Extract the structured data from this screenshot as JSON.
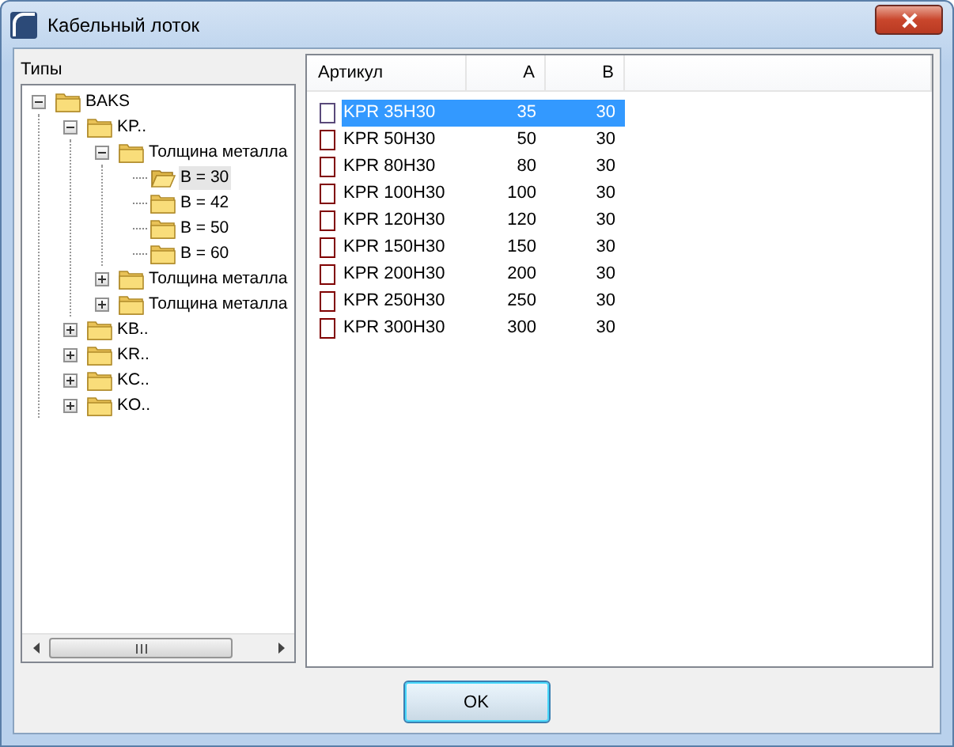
{
  "window": {
    "title": "Кабельный лоток"
  },
  "tree": {
    "label": "Типы",
    "nodes": [
      {
        "label": "BAKS",
        "expanded": true,
        "selected": false,
        "children": [
          {
            "label": "KP..",
            "expanded": true,
            "selected": false,
            "children": [
              {
                "label": "Толщина металла",
                "expanded": true,
                "selected": false,
                "children": [
                  {
                    "label": "B = 30",
                    "selected": true
                  },
                  {
                    "label": "B = 42",
                    "selected": false
                  },
                  {
                    "label": "B = 50",
                    "selected": false
                  },
                  {
                    "label": "B = 60",
                    "selected": false
                  }
                ]
              },
              {
                "label": "Толщина металла",
                "expanded": false,
                "selected": false
              },
              {
                "label": "Толщина металла",
                "expanded": false,
                "selected": false
              }
            ]
          },
          {
            "label": "KB..",
            "expanded": false,
            "selected": false
          },
          {
            "label": "KR..",
            "expanded": false,
            "selected": false
          },
          {
            "label": "KC..",
            "expanded": false,
            "selected": false
          },
          {
            "label": "KO..",
            "expanded": false,
            "selected": false
          }
        ]
      }
    ]
  },
  "table": {
    "columns": [
      "Артикул",
      "A",
      "B"
    ],
    "rows": [
      {
        "cells": [
          "KPR 35H30",
          "35",
          "30"
        ],
        "checked": false,
        "selected": true
      },
      {
        "cells": [
          "KPR 50H30",
          "50",
          "30"
        ],
        "checked": false,
        "selected": false
      },
      {
        "cells": [
          "KPR 80H30",
          "80",
          "30"
        ],
        "checked": false,
        "selected": false
      },
      {
        "cells": [
          "KPR 100H30",
          "100",
          "30"
        ],
        "checked": false,
        "selected": false
      },
      {
        "cells": [
          "KPR 120H30",
          "120",
          "30"
        ],
        "checked": false,
        "selected": false
      },
      {
        "cells": [
          "KPR 150H30",
          "150",
          "30"
        ],
        "checked": false,
        "selected": false
      },
      {
        "cells": [
          "KPR 200H30",
          "200",
          "30"
        ],
        "checked": false,
        "selected": false
      },
      {
        "cells": [
          "KPR 250H30",
          "250",
          "30"
        ],
        "checked": false,
        "selected": false
      },
      {
        "cells": [
          "KPR 300H30",
          "300",
          "30"
        ],
        "checked": false,
        "selected": false
      }
    ]
  },
  "buttons": [
    "OK"
  ]
}
